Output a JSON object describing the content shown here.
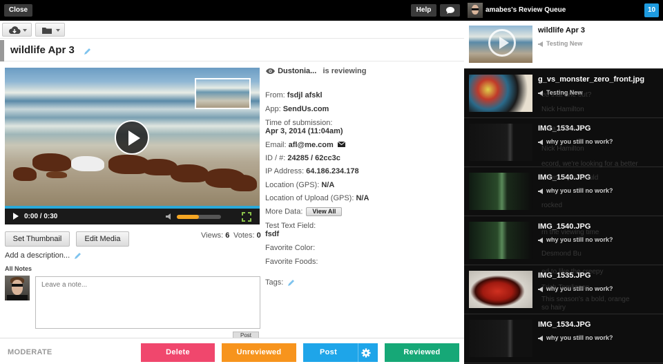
{
  "topbar": {
    "close_label": "Close",
    "help_label": "Help"
  },
  "title": "wildlife Apr 3",
  "video": {
    "time": "0:00 / 0:30",
    "volume_level": 0.5
  },
  "buttons": {
    "set_thumbnail": "Set Thumbnail",
    "edit_media": "Edit Media"
  },
  "stats": {
    "views_label": "Views:",
    "views": "6",
    "votes_label": "Votes:",
    "votes": "0"
  },
  "description_placeholder": "Add a description...",
  "notes": {
    "label": "All Notes",
    "placeholder": "Leave a note...",
    "post_label": "Post"
  },
  "details": {
    "reviewer": "Dustonia...",
    "reviewing_text": "is reviewing",
    "from_label": "From:",
    "from": "fsdjl afskl",
    "app_label": "App:",
    "app": "SendUs.com",
    "time_label": "Time of submission:",
    "time": "Apr 3, 2014 (11:04am)",
    "email_label": "Email:",
    "email": "afl@me.com",
    "id_label": "ID / #:",
    "id": "24285 / 62cc3c",
    "ip_label": "IP Address:",
    "ip": "64.186.234.178",
    "loc_gps_label": "Location (GPS):",
    "loc_gps": "N/A",
    "loc_upload_label": "Location of Upload (GPS):",
    "loc_upload": "N/A",
    "more_data_label": "More Data:",
    "view_all": "View All",
    "test_text_label": "Test Text Field:",
    "test_text": "fsdf",
    "fav_color_label": "Favorite Color:",
    "fav_foods_label": "Favorite Foods:",
    "tags_label": "Tags:"
  },
  "actions": {
    "moderate": "MODERATE",
    "delete": "Delete",
    "unreviewed": "Unreviewed",
    "post": "Post",
    "reviewed": "Reviewed",
    "colors": {
      "delete": "#f0476d",
      "unreviewed": "#f7941d",
      "post": "#1ea5e9",
      "reviewed": "#16a877"
    }
  },
  "queue": {
    "title": "amabes's Review Queue",
    "count": "10",
    "items": [
      {
        "name": "wildlife Apr 3",
        "sub": "Testing New"
      },
      {
        "name": "g_vs_monster_zero_front.jpg",
        "sub": "Testing New"
      },
      {
        "name": "IMG_1534.JPG",
        "sub": "why you still no work?"
      },
      {
        "name": "IMG_1540.JPG",
        "sub": "why you still no work?"
      },
      {
        "name": "IMG_1540.JPG",
        "sub": "why you still no work?"
      },
      {
        "name": "IMG_1535.JPG",
        "sub": "why you still no work?"
      },
      {
        "name": "IMG_1534.JPG",
        "sub": "why you still no work?"
      }
    ],
    "ghost_text": [
      "ed that one out?",
      "Nick Hamilton",
      "e's a photo of",
      "Nick Hamilton",
      "ecord, we're looking for a better",
      "l, Jen, if you would",
      "rocked",
      "rn the viewing time",
      "Desmond Bu",
      "ed to like the creepy",
      "Trish Tomlinson",
      "This season's a bold, orange",
      "so hairy"
    ]
  }
}
